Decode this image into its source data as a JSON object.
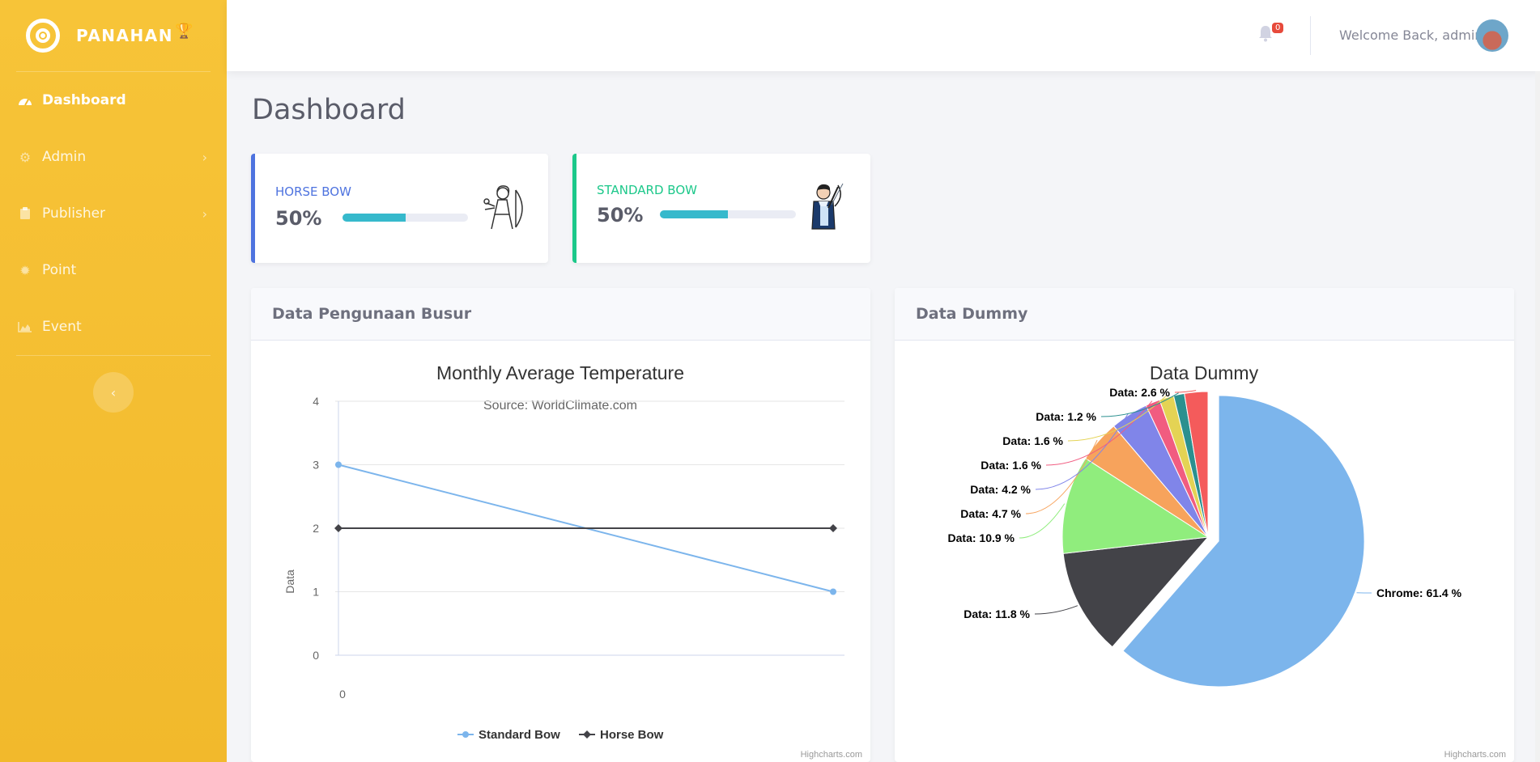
{
  "brand": {
    "name": "PANAHAN"
  },
  "sidebar": {
    "items": [
      {
        "label": "Dashboard",
        "icon": "tachometer-icon",
        "active": true
      },
      {
        "label": "Admin",
        "icon": "gear-icon",
        "has_children": true
      },
      {
        "label": "Publisher",
        "icon": "clipboard-icon",
        "has_children": true
      },
      {
        "label": "Point",
        "icon": "cog-icon"
      },
      {
        "label": "Event",
        "icon": "area-chart-icon"
      }
    ]
  },
  "topbar": {
    "notification_count": "0",
    "welcome_text": "Welcome Back, admin"
  },
  "page": {
    "title": "Dashboard"
  },
  "stats": [
    {
      "label": "HORSE BOW",
      "value": "50%",
      "progress": 0.5,
      "accent": "#4e73df"
    },
    {
      "label": "STANDARD BOW",
      "value": "50%",
      "progress": 0.5,
      "accent": "#1cc88a"
    }
  ],
  "panels": {
    "line_panel_title": "Data Pengunaan Busur",
    "pie_panel_title": "Data Dummy"
  },
  "chart_data": [
    {
      "type": "line",
      "title": "Monthly Average Temperature",
      "subtitle": "Source: WorldClimate.com",
      "ylabel": "Data",
      "ylim": [
        0,
        4
      ],
      "yticks": [
        "0",
        "1",
        "2",
        "3",
        "4"
      ],
      "x_label_text": "0",
      "series": [
        {
          "name": "Standard Bow",
          "values": [
            3,
            1
          ],
          "color": "#7cb5ec"
        },
        {
          "name": "Horse Bow",
          "values": [
            2,
            2
          ],
          "color": "#434348"
        }
      ],
      "credit": "Highcharts.com"
    },
    {
      "type": "pie",
      "title": "Data Dummy",
      "slices": [
        {
          "label": "Chrome: 61.4 %",
          "value": 61.4,
          "color": "#7cb5ec"
        },
        {
          "label": "Data: 11.8 %",
          "value": 11.8,
          "color": "#434348"
        },
        {
          "label": "Data: 10.9 %",
          "value": 10.9,
          "color": "#90ed7d"
        },
        {
          "label": "Data: 4.7 %",
          "value": 4.7,
          "color": "#f7a35c"
        },
        {
          "label": "Data: 4.2 %",
          "value": 4.2,
          "color": "#8085e9"
        },
        {
          "label": "Data: 1.6 %",
          "value": 1.6,
          "color": "#f15c80"
        },
        {
          "label": "Data: 1.6 %",
          "value": 1.6,
          "color": "#e4d354"
        },
        {
          "label": "Data: 1.2 %",
          "value": 1.2,
          "color": "#2b908f"
        },
        {
          "label": "Data: 2.6 %",
          "value": 2.6,
          "color": "#f45b5b"
        }
      ],
      "credit": "Highcharts.com"
    }
  ]
}
